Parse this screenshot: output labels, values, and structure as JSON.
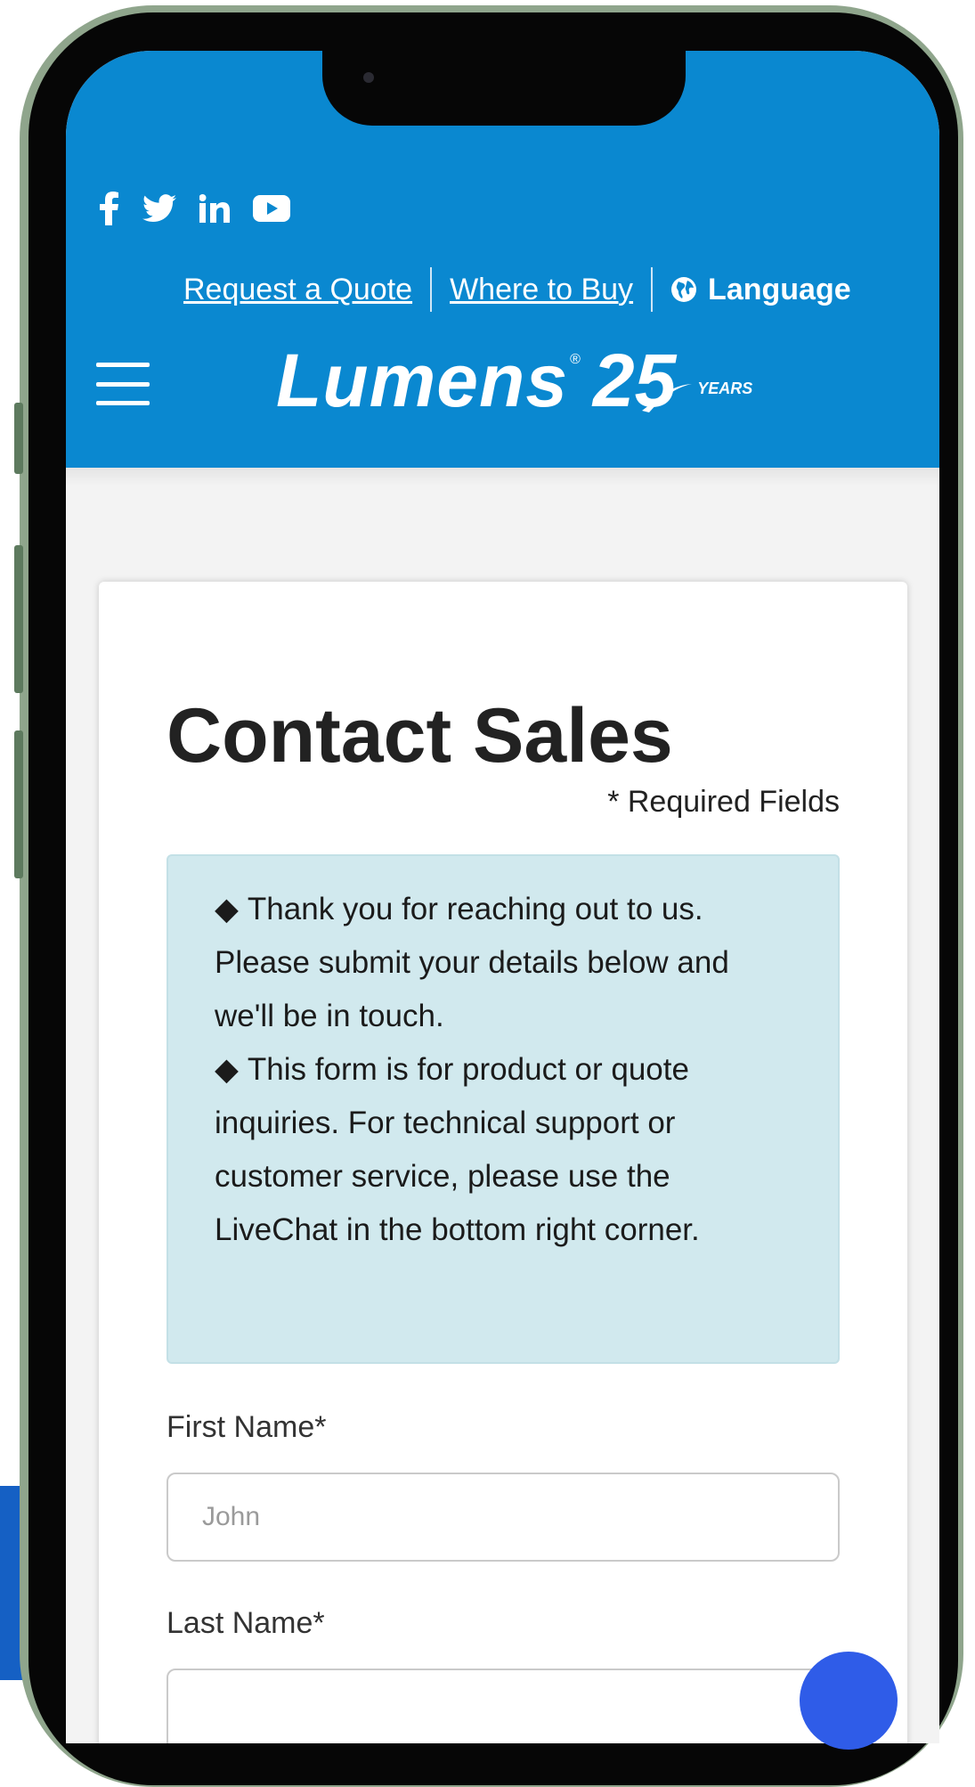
{
  "header": {
    "social_icons": [
      "facebook-icon",
      "twitter-icon",
      "linkedin-icon",
      "youtube-icon"
    ],
    "links": {
      "request_quote": "Request a Quote",
      "where_to_buy": "Where to Buy",
      "language": "Language"
    },
    "logo": {
      "brand": "Lumens",
      "registered": "®",
      "anniversary": "25",
      "years": "YEARS"
    }
  },
  "form": {
    "title": "Contact Sales",
    "required_note": "* Required Fields",
    "info": {
      "bullet": "◆",
      "paragraph1": "Thank you for reaching out to us. Please submit your details below and we'll be in touch.",
      "paragraph2": "This form is for product or quote inquiries. For technical support or customer service, please use the LiveChat in the bottom right corner."
    },
    "first_name": {
      "label": "First Name*",
      "placeholder": "John",
      "value": ""
    },
    "last_name": {
      "label": "Last Name*",
      "placeholder": "",
      "value": ""
    }
  },
  "colors": {
    "header_blue": "#0a88d0",
    "info_bg": "#d1e9ee",
    "chat_blue": "#2f5ce8"
  }
}
